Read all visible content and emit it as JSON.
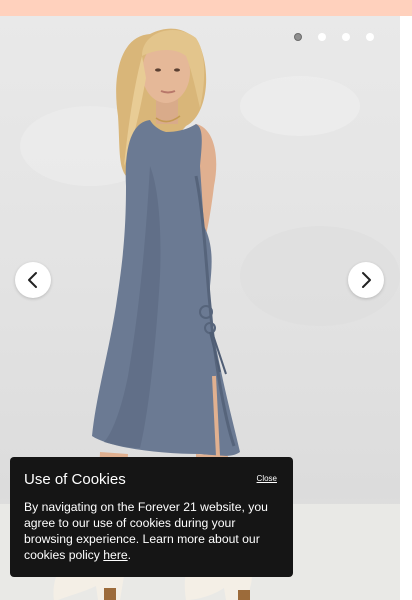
{
  "carousel": {
    "image_subject": "Woman in sleeveless blue-grey midi dress with side tie and beige boots",
    "slide_count": 4,
    "active_slide": 1
  },
  "cookie_banner": {
    "title": "Use of Cookies",
    "close_label": "Close",
    "body_text": "By navigating on the Forever 21 website, you agree to our use of cookies during your browsing experience. Learn more about our cookies policy ",
    "link_label": "here",
    "body_end": "."
  },
  "colors": {
    "top_strip": "#ffd1bd",
    "banner_bg": "#151515",
    "dress": "#6b7a93",
    "backdrop": "#e5e5e5"
  },
  "icons": {
    "prev": "chevron-left-icon",
    "next": "chevron-right-icon"
  }
}
